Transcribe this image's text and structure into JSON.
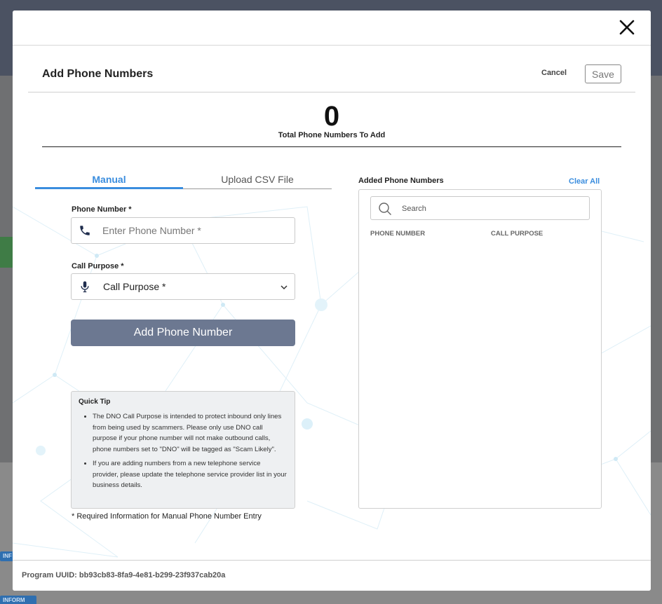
{
  "modal": {
    "title": "Add Phone Numbers",
    "cancel_label": "Cancel",
    "save_label": "Save"
  },
  "summary": {
    "count": "0",
    "label": "Total Phone Numbers To Add"
  },
  "tabs": [
    {
      "label": "Manual",
      "active": true
    },
    {
      "label": "Upload CSV File",
      "active": false
    }
  ],
  "form": {
    "phone_label": "Phone Number *",
    "phone_placeholder": "Enter Phone Number *",
    "phone_value": "",
    "purpose_label": "Call Purpose *",
    "purpose_value": "Call Purpose *",
    "add_button": "Add Phone Number"
  },
  "tip": {
    "title": "Quick Tip",
    "items": [
      "The DNO Call Purpose is intended to protect inbound only lines from being used by scammers. Please only use DNO call purpose if your phone number will not make outbound calls, phone numbers set to \"DNO\" will be tagged as \"Scam Likely\".",
      "If you are adding numbers from a new telephone service provider, please update the telephone service provider list in your business details."
    ]
  },
  "required_note": "* Required Information for Manual Phone Number Entry",
  "added": {
    "title": "Added Phone Numbers",
    "clear_all": "Clear All",
    "search_placeholder": "Search",
    "columns": [
      "PHONE NUMBER",
      "CALL PURPOSE"
    ],
    "rows": []
  },
  "footer": {
    "uuid_text": "Program UUID: bb93cb83-8fa9-4e81-b299-23f937cab20a"
  },
  "background": {
    "badges": [
      "INF",
      "INFORM"
    ]
  },
  "colors": {
    "accent": "#3a8dde",
    "add_button": "#6c7891",
    "backdrop": "#6f7072"
  }
}
